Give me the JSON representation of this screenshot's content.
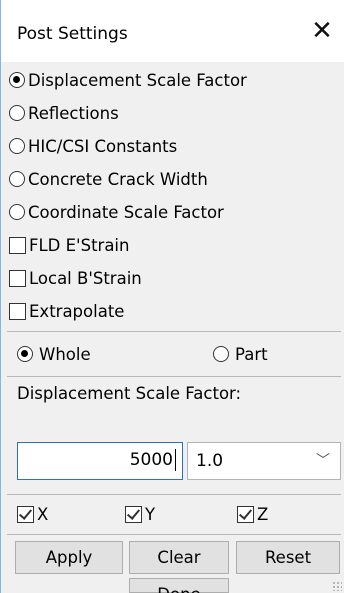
{
  "window": {
    "title": "Post Settings"
  },
  "options": [
    {
      "type": "radio",
      "label": "Displacement Scale Factor",
      "checked": true
    },
    {
      "type": "radio",
      "label": "Reflections",
      "checked": false
    },
    {
      "type": "radio",
      "label": "HIC/CSI Constants",
      "checked": false
    },
    {
      "type": "radio",
      "label": "Concrete Crack Width",
      "checked": false
    },
    {
      "type": "radio",
      "label": "Coordinate Scale Factor",
      "checked": false
    },
    {
      "type": "checkbox",
      "label": "FLD E'Strain",
      "checked": false
    },
    {
      "type": "checkbox",
      "label": "Local B'Strain",
      "checked": false
    },
    {
      "type": "checkbox",
      "label": "Extrapolate",
      "checked": false
    }
  ],
  "scope": {
    "whole": {
      "label": "Whole",
      "checked": true
    },
    "part": {
      "label": "Part",
      "checked": false
    }
  },
  "scale": {
    "label": "Displacement Scale Factor:",
    "value": "5000",
    "select_value": "1.0"
  },
  "axes": [
    {
      "label": "X",
      "checked": true
    },
    {
      "label": "Y",
      "checked": true
    },
    {
      "label": "Z",
      "checked": true
    }
  ],
  "buttons": {
    "apply": "Apply",
    "clear": "Clear",
    "reset": "Reset",
    "done": "Done"
  }
}
